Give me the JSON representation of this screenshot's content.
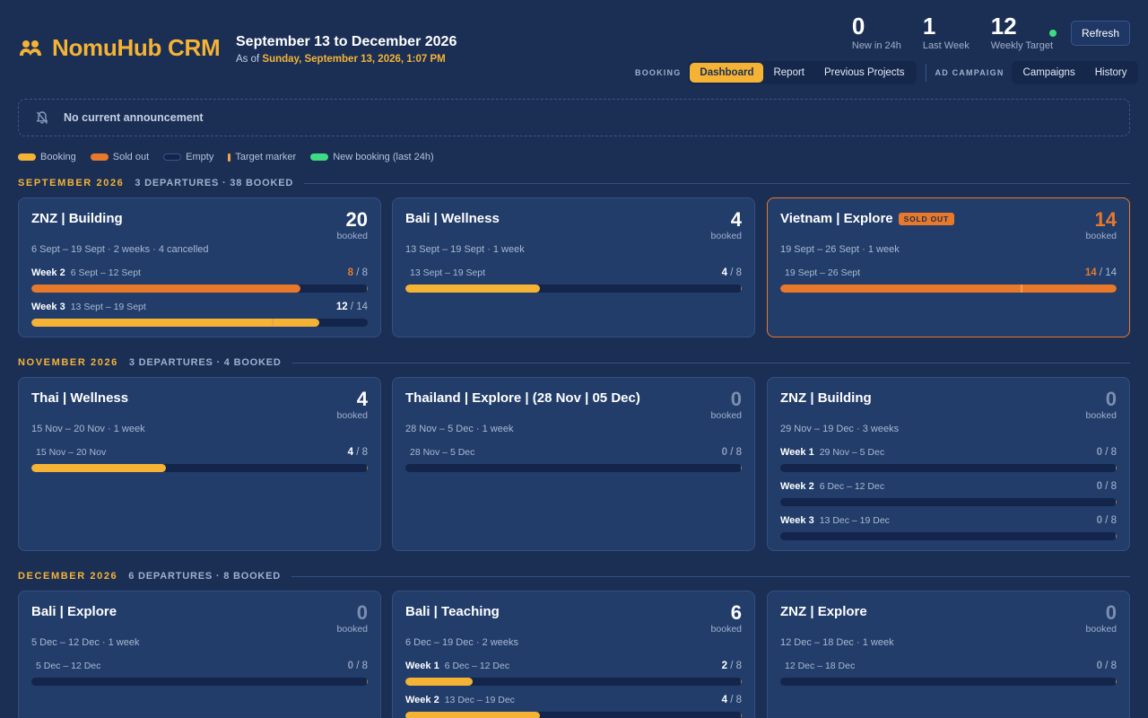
{
  "app": {
    "name": "NomuHub CRM",
    "period_title": "September 13 to December 2026",
    "as_of_prefix": "As of",
    "as_of_value": "Sunday, September 13, 2026, 1:07 PM"
  },
  "stats": [
    {
      "value": "0",
      "label": "New in 24h"
    },
    {
      "value": "1",
      "label": "Last Week"
    },
    {
      "value": "12",
      "label": "Weekly Target"
    }
  ],
  "refresh_label": "Refresh",
  "nav": {
    "booking_caption": "BOOKING",
    "booking_tabs": [
      "Dashboard",
      "Report",
      "Previous Projects"
    ],
    "ad_caption": "AD CAMPAIGN",
    "ad_tabs": [
      "Campaigns",
      "History"
    ]
  },
  "announcement": "No current announcement",
  "legend": [
    "Booking",
    "Sold out",
    "Empty",
    "Target marker",
    "New booking (last 24h)"
  ],
  "colors": {
    "accent": "#f5b335",
    "sold_out": "#e8782a",
    "new_booking": "#3ddc84",
    "background": "#1b2f55",
    "card": "#223d6a"
  },
  "sections": [
    {
      "month": "SEPTEMBER 2026",
      "meta": "3 DEPARTURES · 38 BOOKED",
      "cards": [
        {
          "title": "ZNZ | Building",
          "count": "20",
          "count_label": "booked",
          "sold_out": false,
          "sub": "6 Sept – 19 Sept · 2 weeks · 4 cancelled",
          "weeks": [
            {
              "name": "Week 2",
              "dates": "6 Sept – 12 Sept",
              "booked": "8",
              "capacity": "8",
              "fill": 0.8,
              "state": "sold",
              "target": null
            },
            {
              "name": "Week 3",
              "dates": "13 Sept – 19 Sept",
              "booked": "12",
              "capacity": "14",
              "fill": 0.857,
              "state": "booking",
              "target": 0.714
            }
          ]
        },
        {
          "title": "Bali | Wellness",
          "count": "4",
          "count_label": "booked",
          "sold_out": false,
          "sub": "13 Sept – 19 Sept · 1 week",
          "weeks": [
            {
              "name": "",
              "dates": "13 Sept – 19 Sept",
              "booked": "4",
              "capacity": "8",
              "fill": 0.4,
              "state": "booking",
              "target": null
            }
          ]
        },
        {
          "title": "Vietnam | Explore",
          "badge": "SOLD OUT",
          "count": "14",
          "count_label": "booked",
          "sold_out": true,
          "sub": "19 Sept – 26 Sept · 1 week",
          "weeks": [
            {
              "name": "",
              "dates": "19 Sept – 26 Sept",
              "booked": "14",
              "capacity": "14",
              "fill": 1.0,
              "state": "sold",
              "target": 0.714
            }
          ]
        }
      ]
    },
    {
      "month": "NOVEMBER 2026",
      "meta": "3 DEPARTURES · 4 BOOKED",
      "cards": [
        {
          "title": "Thai | Wellness",
          "count": "4",
          "count_label": "booked",
          "sold_out": false,
          "sub": "15 Nov – 20 Nov · 1 week",
          "weeks": [
            {
              "name": "",
              "dates": "15 Nov – 20 Nov",
              "booked": "4",
              "capacity": "8",
              "fill": 0.4,
              "state": "booking",
              "target": null
            }
          ]
        },
        {
          "title": "Thailand | Explore | (28 Nov | 05 Dec)",
          "count": "0",
          "count_label": "booked",
          "sold_out": false,
          "sub": "28 Nov – 5 Dec · 1 week",
          "weeks": [
            {
              "name": "",
              "dates": "28 Nov – 5 Dec",
              "booked": "0",
              "capacity": "8",
              "fill": 0,
              "state": "empty",
              "target": null
            }
          ]
        },
        {
          "title": "ZNZ | Building",
          "count": "0",
          "count_label": "booked",
          "sold_out": false,
          "sub": "29 Nov – 19 Dec · 3 weeks",
          "weeks": [
            {
              "name": "Week 1",
              "dates": "29 Nov – 5 Dec",
              "booked": "0",
              "capacity": "8",
              "fill": 0,
              "state": "empty",
              "target": null
            },
            {
              "name": "Week 2",
              "dates": "6 Dec – 12 Dec",
              "booked": "0",
              "capacity": "8",
              "fill": 0,
              "state": "empty",
              "target": null
            },
            {
              "name": "Week 3",
              "dates": "13 Dec – 19 Dec",
              "booked": "0",
              "capacity": "8",
              "fill": 0,
              "state": "empty",
              "target": null
            }
          ]
        }
      ]
    },
    {
      "month": "DECEMBER 2026",
      "meta": "6 DEPARTURES · 8 BOOKED",
      "cards": [
        {
          "title": "Bali | Explore",
          "count": "0",
          "count_label": "booked",
          "sold_out": false,
          "sub": "5 Dec – 12 Dec · 1 week",
          "weeks": [
            {
              "name": "",
              "dates": "5 Dec – 12 Dec",
              "booked": "0",
              "capacity": "8",
              "fill": 0,
              "state": "empty",
              "target": null
            }
          ]
        },
        {
          "title": "Bali | Teaching",
          "count": "6",
          "count_label": "booked",
          "sold_out": false,
          "sub": "6 Dec – 19 Dec · 2 weeks",
          "weeks": [
            {
              "name": "Week 1",
              "dates": "6 Dec – 12 Dec",
              "booked": "2",
              "capacity": "8",
              "fill": 0.2,
              "state": "booking",
              "target": null
            },
            {
              "name": "Week 2",
              "dates": "13 Dec – 19 Dec",
              "booked": "4",
              "capacity": "8",
              "fill": 0.4,
              "state": "booking",
              "target": null
            }
          ]
        },
        {
          "title": "ZNZ | Explore",
          "count": "0",
          "count_label": "booked",
          "sold_out": false,
          "sub": "12 Dec – 18 Dec · 1 week",
          "weeks": [
            {
              "name": "",
              "dates": "12 Dec – 18 Dec",
              "booked": "0",
              "capacity": "8",
              "fill": 0,
              "state": "empty",
              "target": null
            }
          ]
        }
      ]
    }
  ]
}
